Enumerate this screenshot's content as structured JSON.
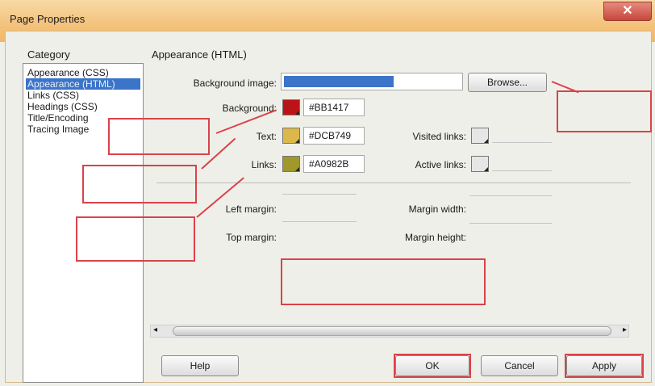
{
  "window": {
    "title": "Page Properties",
    "close_icon": "close-icon"
  },
  "category": {
    "label": "Category",
    "items": [
      "Appearance (CSS)",
      "Appearance (HTML)",
      "Links (CSS)",
      "Headings (CSS)",
      "Title/Encoding",
      "Tracing Image"
    ],
    "selected": "Appearance (HTML)"
  },
  "section": {
    "title": "Appearance (HTML)"
  },
  "fields": {
    "background_image": {
      "label": "Background image:",
      "value": ""
    },
    "browse_label": "Browse...",
    "background": {
      "label": "Background:",
      "color": "#BB1417",
      "value": "#BB1417"
    },
    "text": {
      "label": "Text:",
      "color": "#DCB749",
      "value": "#DCB749"
    },
    "links": {
      "label": "Links:",
      "color": "#A0982B",
      "value": "#A0982B"
    },
    "visited_links": {
      "label": "Visited links:",
      "value": ""
    },
    "active_links": {
      "label": "Active links:",
      "value": ""
    },
    "left_margin": {
      "label": "Left margin:",
      "value": ""
    },
    "top_margin": {
      "label": "Top margin:",
      "value": ""
    },
    "margin_width": {
      "label": "Margin width:",
      "value": ""
    },
    "margin_height": {
      "label": "Margin height:",
      "value": ""
    }
  },
  "buttons": {
    "help": "Help",
    "ok": "OK",
    "cancel": "Cancel",
    "apply": "Apply"
  },
  "colors": {
    "annotation": "#D9434A",
    "selection": "#3B74C8"
  }
}
